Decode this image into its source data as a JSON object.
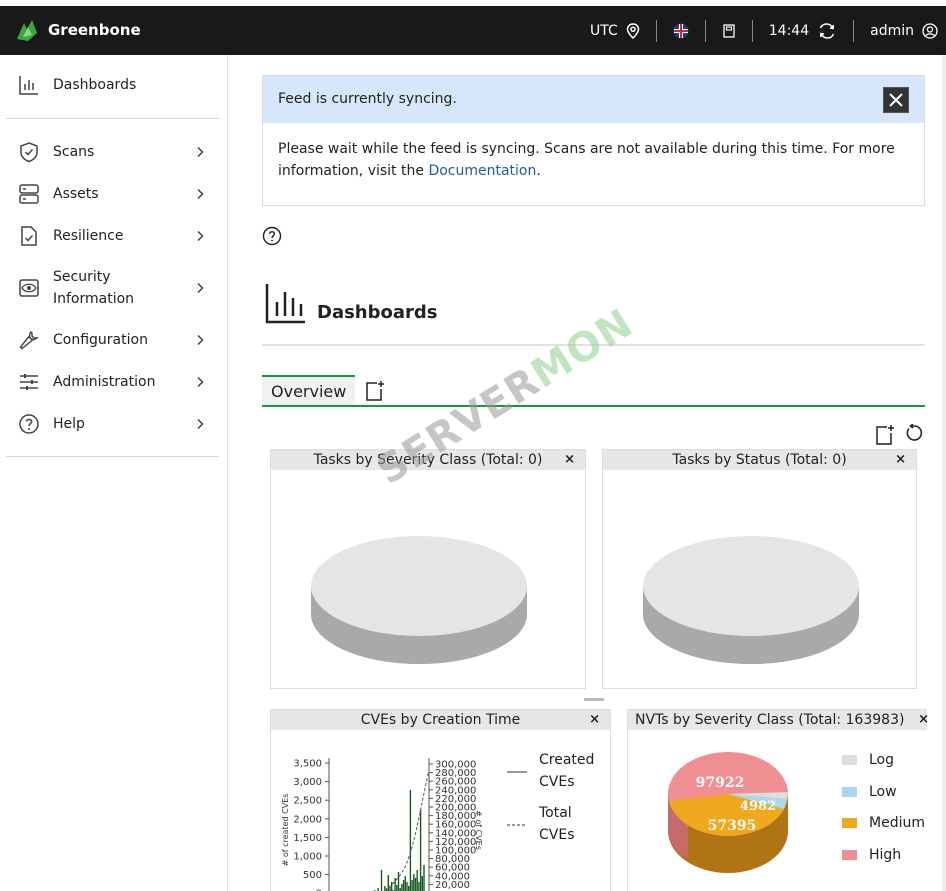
{
  "topbar": {
    "brand": "Greenbone",
    "timezone": "UTC",
    "time": "14:44",
    "user": "admin"
  },
  "sidebar": {
    "items": [
      {
        "label": "Dashboards",
        "icon": "bar-chart-icon"
      },
      {
        "label": "Scans",
        "icon": "shield-check-icon"
      },
      {
        "label": "Assets",
        "icon": "server-icon"
      },
      {
        "label": "Resilience",
        "icon": "document-check-icon"
      },
      {
        "label": "Security Information",
        "icon": "eye-icon"
      },
      {
        "label": "Configuration",
        "icon": "wrench-icon"
      },
      {
        "label": "Administration",
        "icon": "sliders-icon"
      },
      {
        "label": "Help",
        "icon": "question-circle-icon"
      }
    ]
  },
  "banner": {
    "title": "Feed is currently syncing.",
    "body": "Please wait while the feed is syncing. Scans are not available during this time. For more information, visit the",
    "link": "Documentation",
    "end": "."
  },
  "page": {
    "title": "Dashboards",
    "tab": "Overview"
  },
  "cards": {
    "severity": "Tasks by Severity Class (Total: 0)",
    "status": "Tasks by Status (Total: 0)",
    "cves": "CVEs by Creation Time",
    "nvts": "NVTs by Severity Class (Total: 163983)",
    "close": "×"
  },
  "cve_legend": {
    "created": "Created CVEs",
    "total": "Total CVEs",
    "y_left_label": "# of created CVEs",
    "y_right_label": "# of CVEs"
  },
  "nvt_legend": [
    "Log",
    "Low",
    "Medium",
    "High"
  ],
  "watermark": {
    "a": "SERVER",
    "b": "MON"
  },
  "colors": {
    "accent": "#139b39",
    "log": "#dddddd",
    "low": "#a8d8ea",
    "medium": "#f0a81c",
    "high": "#ef8f91"
  },
  "chart_data": [
    {
      "type": "bar",
      "title": "CVEs by Creation Time",
      "ylabel": "# of created CVEs",
      "y_ticks": [
        "3,500",
        "3,000",
        "2,500",
        "2,000",
        "1,500",
        "1,000",
        "500",
        "0"
      ],
      "y2_ticks": [
        "300,000",
        "280,000",
        "260,000",
        "240,000",
        "220,000",
        "200,000",
        "180,000",
        "160,000",
        "140,000",
        "120,000",
        "100,000",
        "80,000",
        "60,000",
        "40,000",
        "20,000"
      ],
      "series": [
        {
          "name": "Created CVEs"
        },
        {
          "name": "Total CVEs"
        }
      ]
    },
    {
      "type": "pie",
      "title": "NVTs by Severity Class (Total: 163983)",
      "categories": [
        "Log",
        "Low",
        "Medium",
        "High"
      ],
      "values": [
        2300,
        1687,
        57395,
        97922
      ],
      "labels": [
        "",
        "4982",
        "57395",
        "97922"
      ]
    }
  ]
}
